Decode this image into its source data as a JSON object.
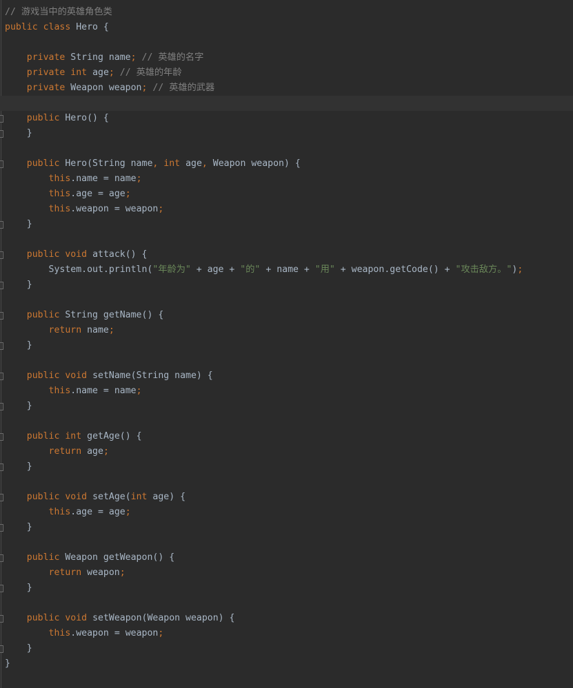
{
  "editor": {
    "theme_colors": {
      "background": "#2b2b2b",
      "current_line": "#323232",
      "comment": "#808080",
      "keyword": "#cc7832",
      "string": "#6a8759",
      "plain": "#a9b7c6"
    },
    "current_line_index": 6,
    "lines": [
      {
        "fold": false,
        "tokens": [
          {
            "t": "comment",
            "v": "// 游戏当中的英雄角色类"
          }
        ]
      },
      {
        "fold": false,
        "tokens": [
          {
            "t": "keyword",
            "v": "public"
          },
          {
            "t": "plain",
            "v": " "
          },
          {
            "t": "keyword",
            "v": "class"
          },
          {
            "t": "plain",
            "v": " Hero {"
          }
        ]
      },
      {
        "fold": false,
        "tokens": []
      },
      {
        "fold": false,
        "tokens": [
          {
            "t": "plain",
            "v": "    "
          },
          {
            "t": "keyword",
            "v": "private"
          },
          {
            "t": "plain",
            "v": " String name"
          },
          {
            "t": "punct",
            "v": ";"
          },
          {
            "t": "plain",
            "v": " "
          },
          {
            "t": "comment",
            "v": "// 英雄的名字"
          }
        ]
      },
      {
        "fold": false,
        "tokens": [
          {
            "t": "plain",
            "v": "    "
          },
          {
            "t": "keyword",
            "v": "private"
          },
          {
            "t": "plain",
            "v": " "
          },
          {
            "t": "keyword",
            "v": "int"
          },
          {
            "t": "plain",
            "v": " age"
          },
          {
            "t": "punct",
            "v": ";"
          },
          {
            "t": "plain",
            "v": " "
          },
          {
            "t": "comment",
            "v": "// 英雄的年龄"
          }
        ]
      },
      {
        "fold": false,
        "tokens": [
          {
            "t": "plain",
            "v": "    "
          },
          {
            "t": "keyword",
            "v": "private"
          },
          {
            "t": "plain",
            "v": " Weapon weapon"
          },
          {
            "t": "punct",
            "v": ";"
          },
          {
            "t": "plain",
            "v": " "
          },
          {
            "t": "comment",
            "v": "// 英雄的武器"
          }
        ]
      },
      {
        "fold": false,
        "tokens": []
      },
      {
        "fold": true,
        "tokens": [
          {
            "t": "plain",
            "v": "    "
          },
          {
            "t": "keyword",
            "v": "public"
          },
          {
            "t": "plain",
            "v": " Hero() {"
          }
        ]
      },
      {
        "fold": true,
        "tokens": [
          {
            "t": "plain",
            "v": "    }"
          }
        ]
      },
      {
        "fold": false,
        "tokens": []
      },
      {
        "fold": true,
        "tokens": [
          {
            "t": "plain",
            "v": "    "
          },
          {
            "t": "keyword",
            "v": "public"
          },
          {
            "t": "plain",
            "v": " Hero(String name"
          },
          {
            "t": "punct",
            "v": ","
          },
          {
            "t": "plain",
            "v": " "
          },
          {
            "t": "keyword",
            "v": "int"
          },
          {
            "t": "plain",
            "v": " age"
          },
          {
            "t": "punct",
            "v": ","
          },
          {
            "t": "plain",
            "v": " Weapon weapon) {"
          }
        ]
      },
      {
        "fold": false,
        "tokens": [
          {
            "t": "plain",
            "v": "        "
          },
          {
            "t": "keyword",
            "v": "this"
          },
          {
            "t": "plain",
            "v": ".name = name"
          },
          {
            "t": "punct",
            "v": ";"
          }
        ]
      },
      {
        "fold": false,
        "tokens": [
          {
            "t": "plain",
            "v": "        "
          },
          {
            "t": "keyword",
            "v": "this"
          },
          {
            "t": "plain",
            "v": ".age = age"
          },
          {
            "t": "punct",
            "v": ";"
          }
        ]
      },
      {
        "fold": false,
        "tokens": [
          {
            "t": "plain",
            "v": "        "
          },
          {
            "t": "keyword",
            "v": "this"
          },
          {
            "t": "plain",
            "v": ".weapon = weapon"
          },
          {
            "t": "punct",
            "v": ";"
          }
        ]
      },
      {
        "fold": true,
        "tokens": [
          {
            "t": "plain",
            "v": "    }"
          }
        ]
      },
      {
        "fold": false,
        "tokens": []
      },
      {
        "fold": true,
        "tokens": [
          {
            "t": "plain",
            "v": "    "
          },
          {
            "t": "keyword",
            "v": "public"
          },
          {
            "t": "plain",
            "v": " "
          },
          {
            "t": "keyword",
            "v": "void"
          },
          {
            "t": "plain",
            "v": " attack() {"
          }
        ]
      },
      {
        "fold": false,
        "tokens": [
          {
            "t": "plain",
            "v": "        System.out.println("
          },
          {
            "t": "string",
            "v": "\"年龄为\""
          },
          {
            "t": "plain",
            "v": " + age + "
          },
          {
            "t": "string",
            "v": "\"的\""
          },
          {
            "t": "plain",
            "v": " + name + "
          },
          {
            "t": "string",
            "v": "\"用\""
          },
          {
            "t": "plain",
            "v": " + weapon.getCode() + "
          },
          {
            "t": "string",
            "v": "\"攻击敌方。\""
          },
          {
            "t": "plain",
            "v": ")"
          },
          {
            "t": "punct",
            "v": ";"
          }
        ]
      },
      {
        "fold": true,
        "tokens": [
          {
            "t": "plain",
            "v": "    }"
          }
        ]
      },
      {
        "fold": false,
        "tokens": []
      },
      {
        "fold": true,
        "tokens": [
          {
            "t": "plain",
            "v": "    "
          },
          {
            "t": "keyword",
            "v": "public"
          },
          {
            "t": "plain",
            "v": " String getName() {"
          }
        ]
      },
      {
        "fold": false,
        "tokens": [
          {
            "t": "plain",
            "v": "        "
          },
          {
            "t": "keyword",
            "v": "return"
          },
          {
            "t": "plain",
            "v": " name"
          },
          {
            "t": "punct",
            "v": ";"
          }
        ]
      },
      {
        "fold": true,
        "tokens": [
          {
            "t": "plain",
            "v": "    }"
          }
        ]
      },
      {
        "fold": false,
        "tokens": []
      },
      {
        "fold": true,
        "tokens": [
          {
            "t": "plain",
            "v": "    "
          },
          {
            "t": "keyword",
            "v": "public"
          },
          {
            "t": "plain",
            "v": " "
          },
          {
            "t": "keyword",
            "v": "void"
          },
          {
            "t": "plain",
            "v": " setName(String name) {"
          }
        ]
      },
      {
        "fold": false,
        "tokens": [
          {
            "t": "plain",
            "v": "        "
          },
          {
            "t": "keyword",
            "v": "this"
          },
          {
            "t": "plain",
            "v": ".name = name"
          },
          {
            "t": "punct",
            "v": ";"
          }
        ]
      },
      {
        "fold": true,
        "tokens": [
          {
            "t": "plain",
            "v": "    }"
          }
        ]
      },
      {
        "fold": false,
        "tokens": []
      },
      {
        "fold": true,
        "tokens": [
          {
            "t": "plain",
            "v": "    "
          },
          {
            "t": "keyword",
            "v": "public"
          },
          {
            "t": "plain",
            "v": " "
          },
          {
            "t": "keyword",
            "v": "int"
          },
          {
            "t": "plain",
            "v": " getAge() {"
          }
        ]
      },
      {
        "fold": false,
        "tokens": [
          {
            "t": "plain",
            "v": "        "
          },
          {
            "t": "keyword",
            "v": "return"
          },
          {
            "t": "plain",
            "v": " age"
          },
          {
            "t": "punct",
            "v": ";"
          }
        ]
      },
      {
        "fold": true,
        "tokens": [
          {
            "t": "plain",
            "v": "    }"
          }
        ]
      },
      {
        "fold": false,
        "tokens": []
      },
      {
        "fold": true,
        "tokens": [
          {
            "t": "plain",
            "v": "    "
          },
          {
            "t": "keyword",
            "v": "public"
          },
          {
            "t": "plain",
            "v": " "
          },
          {
            "t": "keyword",
            "v": "void"
          },
          {
            "t": "plain",
            "v": " setAge("
          },
          {
            "t": "keyword",
            "v": "int"
          },
          {
            "t": "plain",
            "v": " age) {"
          }
        ]
      },
      {
        "fold": false,
        "tokens": [
          {
            "t": "plain",
            "v": "        "
          },
          {
            "t": "keyword",
            "v": "this"
          },
          {
            "t": "plain",
            "v": ".age = age"
          },
          {
            "t": "punct",
            "v": ";"
          }
        ]
      },
      {
        "fold": true,
        "tokens": [
          {
            "t": "plain",
            "v": "    }"
          }
        ]
      },
      {
        "fold": false,
        "tokens": []
      },
      {
        "fold": true,
        "tokens": [
          {
            "t": "plain",
            "v": "    "
          },
          {
            "t": "keyword",
            "v": "public"
          },
          {
            "t": "plain",
            "v": " Weapon getWeapon() {"
          }
        ]
      },
      {
        "fold": false,
        "tokens": [
          {
            "t": "plain",
            "v": "        "
          },
          {
            "t": "keyword",
            "v": "return"
          },
          {
            "t": "plain",
            "v": " weapon"
          },
          {
            "t": "punct",
            "v": ";"
          }
        ]
      },
      {
        "fold": true,
        "tokens": [
          {
            "t": "plain",
            "v": "    }"
          }
        ]
      },
      {
        "fold": false,
        "tokens": []
      },
      {
        "fold": true,
        "tokens": [
          {
            "t": "plain",
            "v": "    "
          },
          {
            "t": "keyword",
            "v": "public"
          },
          {
            "t": "plain",
            "v": " "
          },
          {
            "t": "keyword",
            "v": "void"
          },
          {
            "t": "plain",
            "v": " setWeapon(Weapon weapon) {"
          }
        ]
      },
      {
        "fold": false,
        "tokens": [
          {
            "t": "plain",
            "v": "        "
          },
          {
            "t": "keyword",
            "v": "this"
          },
          {
            "t": "plain",
            "v": ".weapon = weapon"
          },
          {
            "t": "punct",
            "v": ";"
          }
        ]
      },
      {
        "fold": true,
        "tokens": [
          {
            "t": "plain",
            "v": "    }"
          }
        ]
      },
      {
        "fold": false,
        "tokens": [
          {
            "t": "plain",
            "v": "}"
          }
        ]
      }
    ]
  }
}
